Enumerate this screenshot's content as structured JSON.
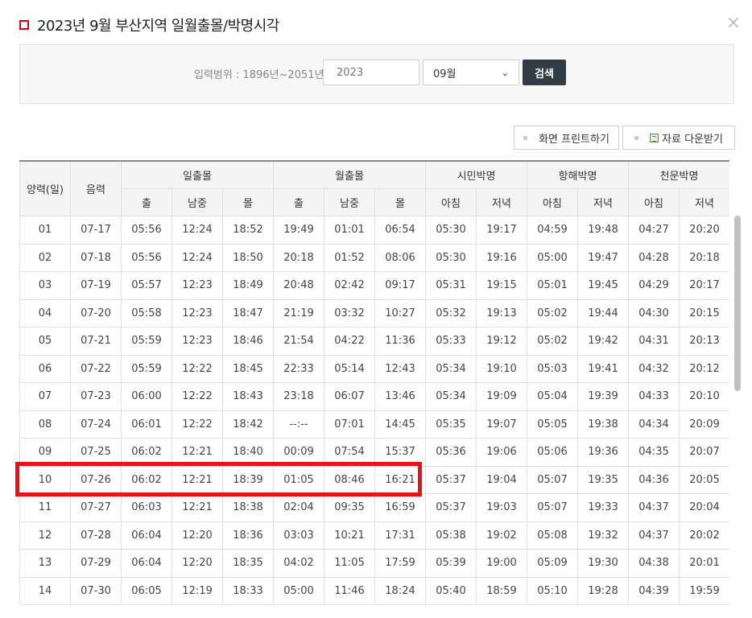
{
  "title": "2023년 9월 부산지역 일월출몰/박명시각",
  "close_label": "×",
  "search": {
    "range_label": "입력범위 : 1896년~2051년",
    "year_placeholder": "2023",
    "month_value": "09월",
    "chevron_icon": "chevron-down-icon",
    "search_label": "검색"
  },
  "actions": {
    "print_label": "화면 프린트하기",
    "download_label": "자료 다운받기"
  },
  "table": {
    "headers": {
      "solar_date": "양력(일)",
      "lunar_date": "음력",
      "sun_group": "일출몰",
      "moon_group": "월출몰",
      "civil_group": "시민박명",
      "nautical_group": "항해박명",
      "astro_group": "천문박명",
      "rise": "출",
      "transit": "남중",
      "set": "몰",
      "morning": "아침",
      "evening": "저녁"
    },
    "rows": [
      [
        "01",
        "07-17",
        "05:56",
        "12:24",
        "18:52",
        "19:49",
        "01:01",
        "06:54",
        "05:30",
        "19:17",
        "04:59",
        "19:48",
        "04:27",
        "20:20"
      ],
      [
        "02",
        "07-18",
        "05:56",
        "12:24",
        "18:50",
        "20:18",
        "01:52",
        "08:06",
        "05:30",
        "19:16",
        "05:00",
        "19:47",
        "04:28",
        "20:18"
      ],
      [
        "03",
        "07-19",
        "05:57",
        "12:23",
        "18:49",
        "20:48",
        "02:42",
        "09:17",
        "05:31",
        "19:15",
        "05:01",
        "19:45",
        "04:29",
        "20:17"
      ],
      [
        "04",
        "07-20",
        "05:58",
        "12:23",
        "18:47",
        "21:19",
        "03:32",
        "10:27",
        "05:32",
        "19:13",
        "05:02",
        "19:44",
        "04:30",
        "20:15"
      ],
      [
        "05",
        "07-21",
        "05:59",
        "12:23",
        "18:46",
        "21:54",
        "04:22",
        "11:36",
        "05:33",
        "19:12",
        "05:02",
        "19:42",
        "04:31",
        "20:13"
      ],
      [
        "06",
        "07-22",
        "05:59",
        "12:22",
        "18:45",
        "22:33",
        "05:14",
        "12:43",
        "05:34",
        "19:10",
        "05:03",
        "19:41",
        "04:32",
        "20:12"
      ],
      [
        "07",
        "07-23",
        "06:00",
        "12:22",
        "18:43",
        "23:18",
        "06:07",
        "13:46",
        "05:34",
        "19:09",
        "05:04",
        "19:39",
        "04:33",
        "20:10"
      ],
      [
        "08",
        "07-24",
        "06:01",
        "12:22",
        "18:42",
        "--:--",
        "07:01",
        "14:45",
        "05:35",
        "19:07",
        "05:05",
        "19:38",
        "04:34",
        "20:09"
      ],
      [
        "09",
        "07-25",
        "06:02",
        "12:21",
        "18:40",
        "00:09",
        "07:54",
        "15:37",
        "05:36",
        "19:06",
        "05:06",
        "19:36",
        "04:35",
        "20:07"
      ],
      [
        "10",
        "07-26",
        "06:02",
        "12:21",
        "18:39",
        "01:05",
        "08:46",
        "16:21",
        "05:37",
        "19:04",
        "05:07",
        "19:35",
        "04:36",
        "20:05"
      ],
      [
        "11",
        "07-27",
        "06:03",
        "12:21",
        "18:38",
        "02:04",
        "09:35",
        "16:59",
        "05:37",
        "19:03",
        "05:07",
        "19:33",
        "04:37",
        "20:04"
      ],
      [
        "12",
        "07-28",
        "06:04",
        "12:20",
        "18:36",
        "03:03",
        "10:21",
        "17:31",
        "05:38",
        "19:02",
        "05:08",
        "19:32",
        "04:37",
        "20:02"
      ],
      [
        "13",
        "07-29",
        "06:04",
        "12:20",
        "18:35",
        "04:02",
        "11:05",
        "17:59",
        "05:39",
        "19:00",
        "05:09",
        "19:30",
        "04:38",
        "20:01"
      ],
      [
        "14",
        "07-30",
        "06:05",
        "12:19",
        "18:33",
        "05:00",
        "11:46",
        "18:24",
        "05:40",
        "18:59",
        "05:10",
        "19:28",
        "04:39",
        "19:59"
      ]
    ]
  },
  "colors": {
    "title_mark": "#d7000f",
    "search_button": "#333b46",
    "highlight": "#e8131a"
  }
}
